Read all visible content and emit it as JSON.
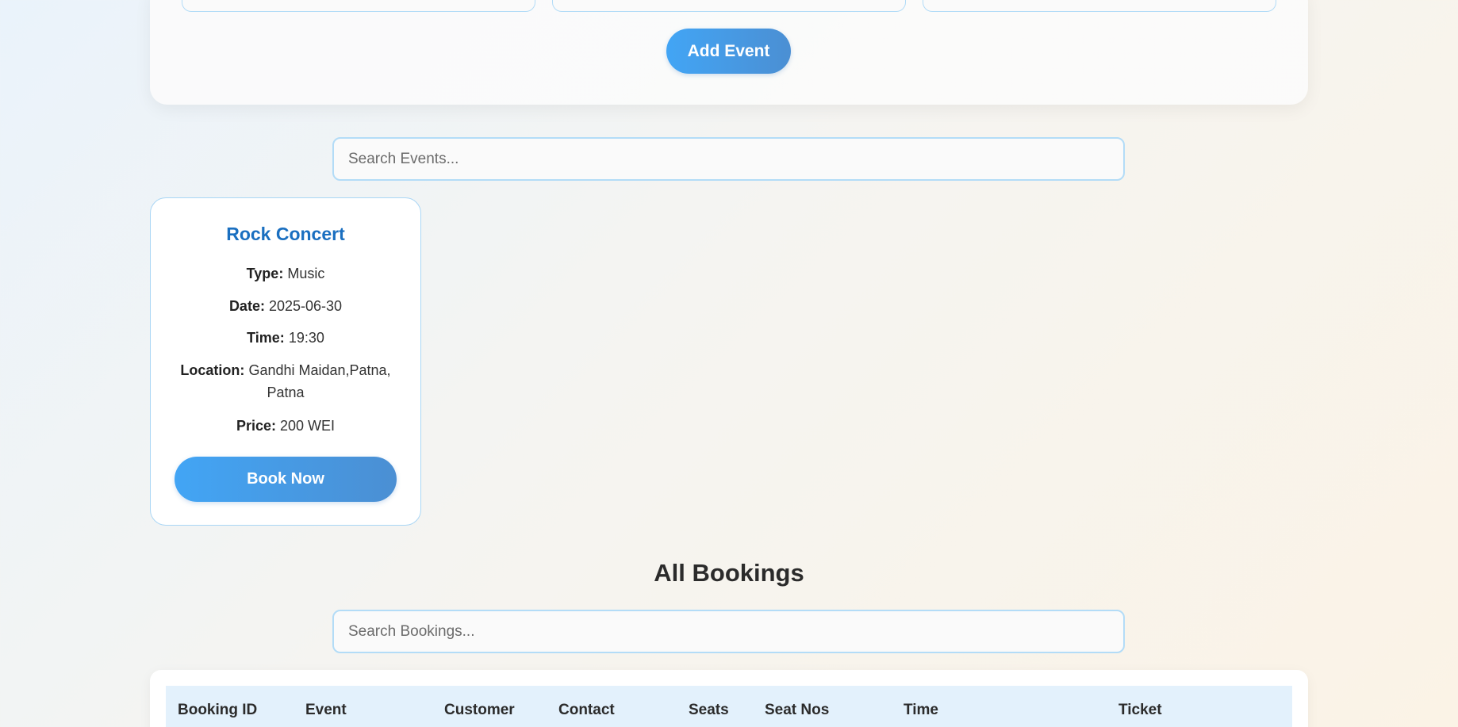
{
  "add_event_form": {
    "submit_label": "Add Event"
  },
  "events_search": {
    "placeholder": "Search Events..."
  },
  "events": [
    {
      "title": "Rock Concert",
      "type_label": "Type:",
      "type": "Music",
      "date_label": "Date:",
      "date": "2025-06-30",
      "time_label": "Time:",
      "time": "19:30",
      "location_label": "Location:",
      "location": "Gandhi Maidan,Patna, Patna",
      "price_label": "Price:",
      "price": "200 WEI",
      "book_label": "Book Now"
    }
  ],
  "bookings": {
    "heading": "All Bookings",
    "search_placeholder": "Search Bookings...",
    "columns": [
      "Booking ID",
      "Event",
      "Customer",
      "Contact",
      "Seats",
      "Seat Nos",
      "Time",
      "Ticket"
    ]
  },
  "colors": {
    "accent": "#42a5f5",
    "accent_dark": "#4b8fd3",
    "title_blue": "#1a6fc0",
    "border_blue": "#b3dcf7",
    "table_header_bg": "#e3f1fc"
  }
}
